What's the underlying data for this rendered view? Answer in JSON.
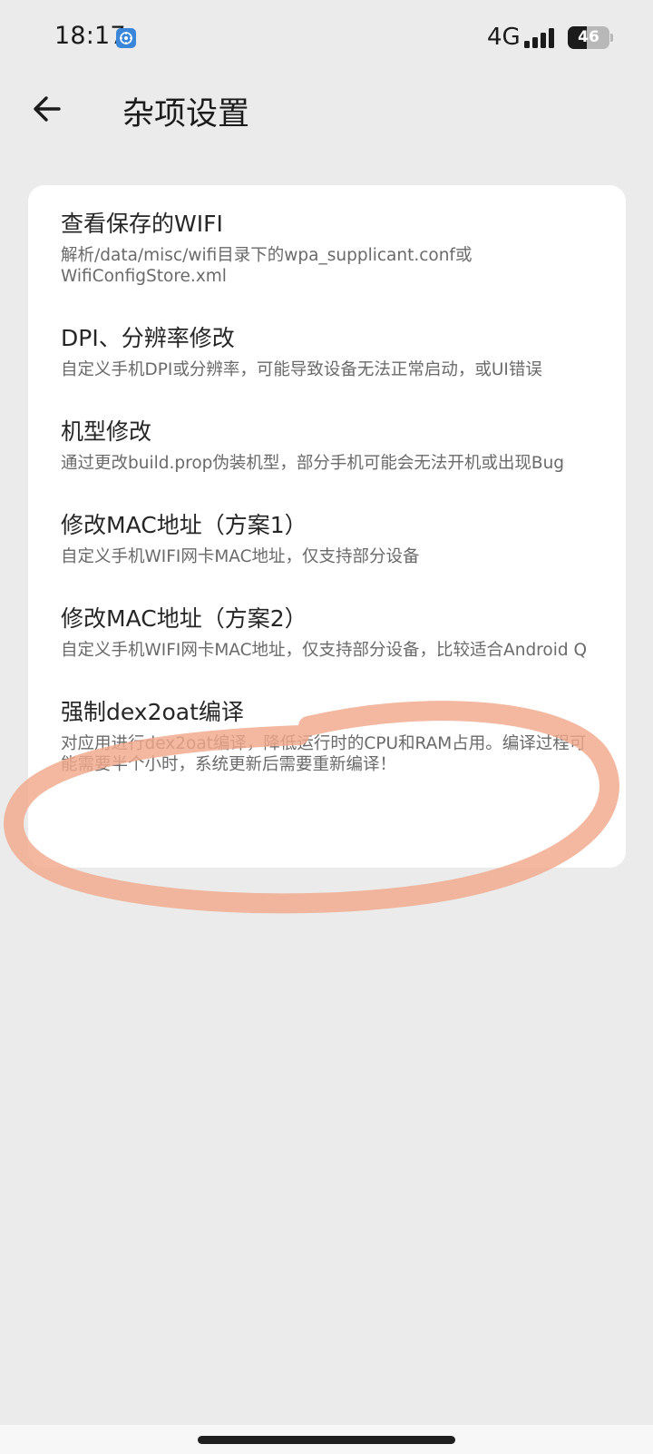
{
  "status_bar": {
    "time": "18:17",
    "network": "4G",
    "battery": "46",
    "battery_level": 0.46,
    "icons": [
      "app-notification-icon",
      "signal-icon",
      "battery-icon"
    ]
  },
  "app_bar": {
    "back_icon": "arrow-left-icon",
    "title": "杂项设置"
  },
  "settings": [
    {
      "title": "查看保存的WIFI",
      "desc": "解析/data/misc/wifi目录下的wpa_supplicant.conf或WifiConfigStore.xml"
    },
    {
      "title": "DPI、分辨率修改",
      "desc": "自定义手机DPI或分辨率，可能导致设备无法正常启动，或UI错误"
    },
    {
      "title": "机型修改",
      "desc": "通过更改build.prop伪装机型，部分手机可能会无法开机或出现Bug"
    },
    {
      "title": "修改MAC地址（方案1）",
      "desc": "自定义手机WIFI网卡MAC地址，仅支持部分设备"
    },
    {
      "title": "修改MAC地址（方案2）",
      "desc": "自定义手机WIFI网卡MAC地址，仅支持部分设备，比较适合Android Q"
    },
    {
      "title": "强制dex2oat编译",
      "desc": "对应用进行dex2oat编译，降低运行时的CPU和RAM占用。编译过程可能需要半个小时，系统更新后需要重新编译！"
    }
  ],
  "colors": {
    "background": "#ebebeb",
    "card": "#ffffff",
    "annotation": "#f0a88a",
    "title_text": "#262626",
    "desc_text": "#6a6a6a"
  }
}
